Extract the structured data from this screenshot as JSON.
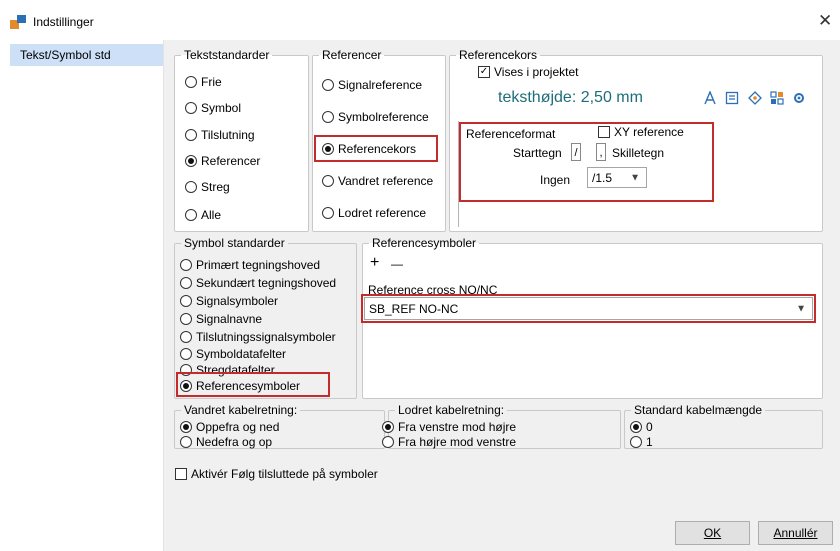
{
  "window": {
    "title": "Indstillinger",
    "close_glyph": "✕"
  },
  "sidebar": {
    "items": [
      {
        "label": "Tekst/Symbol std",
        "selected": true
      }
    ]
  },
  "tekststandarder": {
    "legend": "Tekststandarder",
    "options": [
      "Frie",
      "Symbol",
      "Tilslutning",
      "Referencer",
      "Streg",
      "Alle"
    ],
    "selected": "Referencer"
  },
  "referencer": {
    "legend": "Referencer",
    "options": [
      "Signalreference",
      "Symbolreference",
      "Referencekors",
      "Vandret reference",
      "Lodret reference"
    ],
    "selected": "Referencekors"
  },
  "referencekors": {
    "legend": "Referencekors",
    "vises_label": "Vises i projektet",
    "vises_checked": true,
    "text_height": "teksthøjde: 2,50 mm",
    "text_height_color": "#1e6e7a",
    "icons": [
      "text-style-icon",
      "text-frame-icon",
      "text-position-icon",
      "text-layout-icon",
      "text-settings-icon"
    ],
    "format_label": "Referenceformat",
    "xy_label": "XY reference",
    "xy_checked": false,
    "starttegn_label": "Starttegn",
    "starttegn_value": "/",
    "skilletegn_value": ",",
    "skilletegn_label": "Skilletegn",
    "ingen_label": "Ingen",
    "format_value": "/1.5"
  },
  "symbol_standarder": {
    "legend": "Symbol standarder",
    "options": [
      "Primært tegningshoved",
      "Sekundært tegningshoved",
      "Signalsymboler",
      "Signalnavne",
      "Tilslutningssignalsymboler",
      "Symboldatafelter",
      "Stregdatafelter",
      "Referencesymboler"
    ],
    "selected": "Referencesymboler"
  },
  "referencesymboler": {
    "legend": "Referencesymboler",
    "add_glyph": "+",
    "remove_glyph": "—",
    "cross_label": "Reference cross NO/NC",
    "cross_value": "SB_REF NO-NC"
  },
  "vandret": {
    "legend": "Vandret kabelretning:",
    "options": [
      "Oppefra og ned",
      "Nedefra og op"
    ],
    "selected": "Oppefra og ned"
  },
  "lodret": {
    "legend": "Lodret kabelretning:",
    "options": [
      "Fra venstre mod højre",
      "Fra højre mod venstre"
    ],
    "selected": "Fra venstre mod højre"
  },
  "kabelmaengde": {
    "legend": "Standard kabelmængde",
    "options": [
      "0",
      "1"
    ],
    "selected": "0"
  },
  "aktiver": {
    "label": "Aktivér Følg tilsluttede på symboler",
    "checked": false
  },
  "buttons": {
    "ok_label": "OK",
    "cancel_label": "Annullér"
  },
  "colors": {
    "highlight": "#c42b2b",
    "selection": "#cde0f7"
  }
}
